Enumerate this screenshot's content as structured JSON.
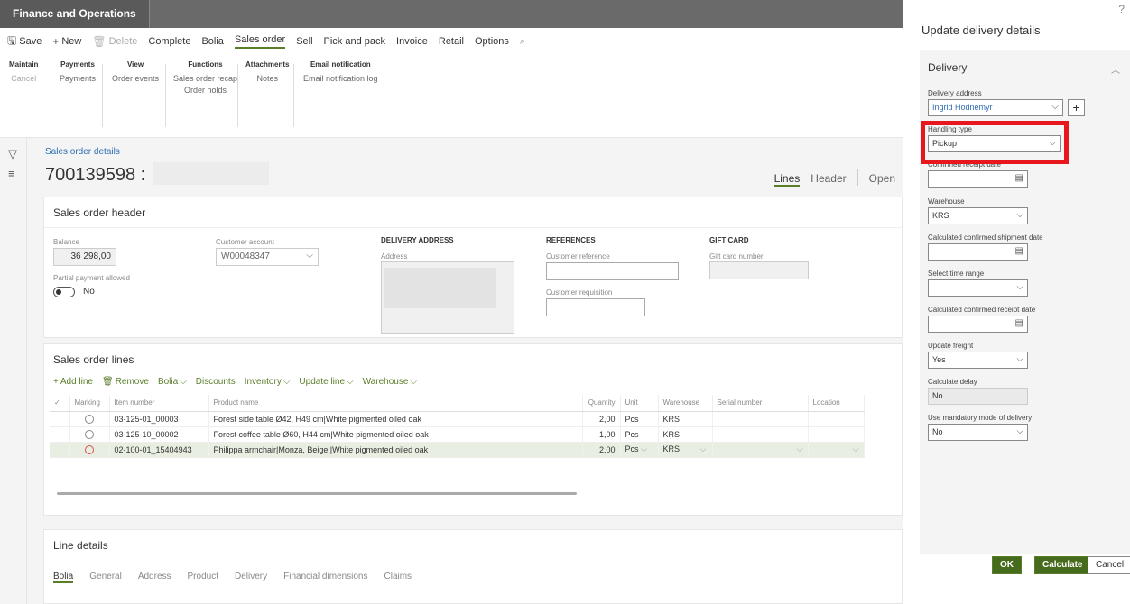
{
  "app": {
    "title": "Finance and Operations"
  },
  "actionbar": {
    "save": "Save",
    "new": "New",
    "delete": "Delete",
    "complete": "Complete",
    "bolia": "Bolia",
    "sales_order": "Sales order",
    "sell": "Sell",
    "pick_and_pack": "Pick and pack",
    "invoice": "Invoice",
    "retail": "Retail",
    "options": "Options"
  },
  "ribbon": {
    "maintain": {
      "header": "Maintain",
      "items": [
        "Cancel"
      ]
    },
    "payments": {
      "header": "Payments",
      "items": [
        "Payments"
      ]
    },
    "view": {
      "header": "View",
      "items": [
        "Order events"
      ]
    },
    "functions": {
      "header": "Functions",
      "items": [
        "Sales order recap",
        "Order holds"
      ]
    },
    "attachments": {
      "header": "Attachments",
      "items": [
        "Notes"
      ]
    },
    "email": {
      "header": "Email notification",
      "items": [
        "Email notification log"
      ]
    }
  },
  "page": {
    "breadcrumb": "Sales order details",
    "order_title": "700139598 :",
    "tabs": {
      "lines": "Lines",
      "header": "Header",
      "open": "Open"
    }
  },
  "header_card": {
    "title": "Sales order header",
    "balance_label": "Balance",
    "balance_value": "36 298,00",
    "partial_label": "Partial payment allowed",
    "partial_value": "No",
    "cust_account_label": "Customer account",
    "cust_account_value": "W00048347",
    "delivery_address_heading": "DELIVERY ADDRESS",
    "address_label": "Address",
    "references_heading": "REFERENCES",
    "cust_ref_label": "Customer reference",
    "cust_req_label": "Customer requisition",
    "gift_heading": "GIFT CARD",
    "gift_label": "Gift card number"
  },
  "lines_card": {
    "title": "Sales order lines",
    "toolbar": {
      "add": "Add line",
      "remove": "Remove",
      "bolia": "Bolia",
      "discounts": "Discounts",
      "inventory": "Inventory",
      "update_line": "Update line",
      "warehouse": "Warehouse"
    },
    "columns": {
      "marking": "Marking",
      "item": "Item number",
      "product": "Product name",
      "qty": "Quantity",
      "unit": "Unit",
      "wh": "Warehouse",
      "serial": "Serial number",
      "location": "Location"
    },
    "rows": [
      {
        "item": "03-125-01_00003",
        "product": "Forest side table Ø42, H49 cm|White pigmented oiled oak",
        "qty": "2,00",
        "unit": "Pcs",
        "wh": "KRS"
      },
      {
        "item": "03-125-10_00002",
        "product": "Forest coffee table Ø60, H44 cm|White pigmented oiled oak",
        "qty": "1,00",
        "unit": "Pcs",
        "wh": "KRS"
      },
      {
        "item": "02-100-01_15404943",
        "product": "Philippa armchair|Monza, Beige||White pigmented oiled oak",
        "qty": "2,00",
        "unit": "Pcs",
        "wh": "KRS"
      }
    ]
  },
  "details_card": {
    "title": "Line details",
    "tabs": {
      "bolia": "Bolia",
      "general": "General",
      "address": "Address",
      "product": "Product",
      "delivery": "Delivery",
      "financial": "Financial dimensions",
      "claims": "Claims"
    }
  },
  "pane": {
    "title": "Update delivery details",
    "help": "?",
    "section": "Delivery",
    "delivery_address_label": "Delivery address",
    "delivery_address_value": "Ingrid Hodnemyr",
    "handling_type_label": "Handling type",
    "handling_type_value": "Pickup",
    "confirmed_receipt_label": "Confirmed receipt date",
    "warehouse_label": "Warehouse",
    "warehouse_value": "KRS",
    "calc_ship_label": "Calculated confirmed shipment date",
    "time_range_label": "Select time range",
    "calc_receipt_label": "Calculated confirmed receipt date",
    "freight_label": "Update freight",
    "freight_value": "Yes",
    "delay_label": "Calculate delay",
    "delay_value": "No",
    "mandatory_label": "Use mandatory mode of delivery",
    "mandatory_value": "No",
    "ok": "OK",
    "calculate": "Calculate",
    "cancel": "Cancel"
  },
  "colors": {
    "accent": "#476b1c",
    "highlight": "#e8171e",
    "link": "#2c6db2"
  }
}
